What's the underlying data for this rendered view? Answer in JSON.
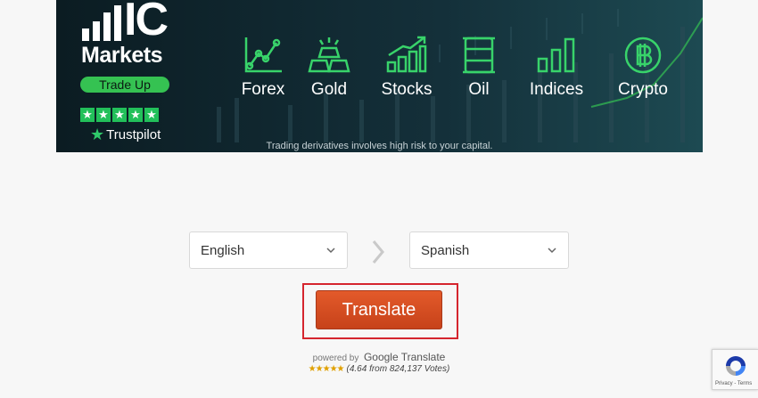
{
  "banner": {
    "logo_ic": "IC",
    "logo_markets": "Markets",
    "tagline": "Trade Up",
    "trustpilot": "Trustpilot",
    "categories": [
      "Forex",
      "Gold",
      "Stocks",
      "Oil",
      "Indices",
      "Crypto"
    ],
    "disclaimer": "Trading derivatives involves high risk to your capital.",
    "colors": {
      "accent_green": "#35c252",
      "background": "#0d1b22"
    }
  },
  "translator": {
    "source_language": "English",
    "target_language": "Spanish",
    "translate_label": "Translate",
    "powered_by": "powered by",
    "google_translate": "Google Translate",
    "rating_text": "(4.64 from 824,137 Votes)",
    "button_color": "#d84e20",
    "highlight_color": "#d5252e"
  },
  "recaptcha": {
    "links": "Privacy - Terms"
  }
}
